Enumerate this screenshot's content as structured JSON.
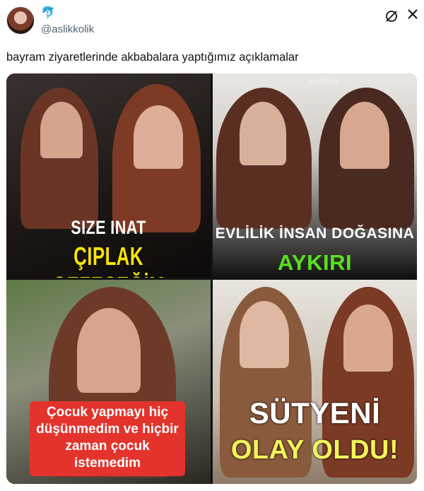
{
  "post": {
    "author_badge_icon": "dolphin-icon",
    "handle": "@aslikkolik",
    "text": "bayram ziyaretlerinde akbabalara yaptığımız açıklamalar"
  },
  "media": {
    "panels": [
      {
        "caption_line1": "SIZE INAT",
        "caption_line2": "ÇIPLAK GEZECEĞİM"
      },
      {
        "watermark": "azintliks",
        "caption_line1": "EVLİLİK İNSAN DOĞASINA",
        "caption_line2": "AYKIRI"
      },
      {
        "caption": "Çocuk yapmayı hiç düşünmedim ve hiçbir zaman çocuk istemedim"
      },
      {
        "caption_line1": "SÜTYENİ",
        "caption_line2": "OLAY OLDU!"
      }
    ]
  },
  "colors": {
    "yellow_caption": "#f7e300",
    "green_caption": "#58e11f",
    "red_box": "#e4332c",
    "handle_gray": "#536471"
  }
}
